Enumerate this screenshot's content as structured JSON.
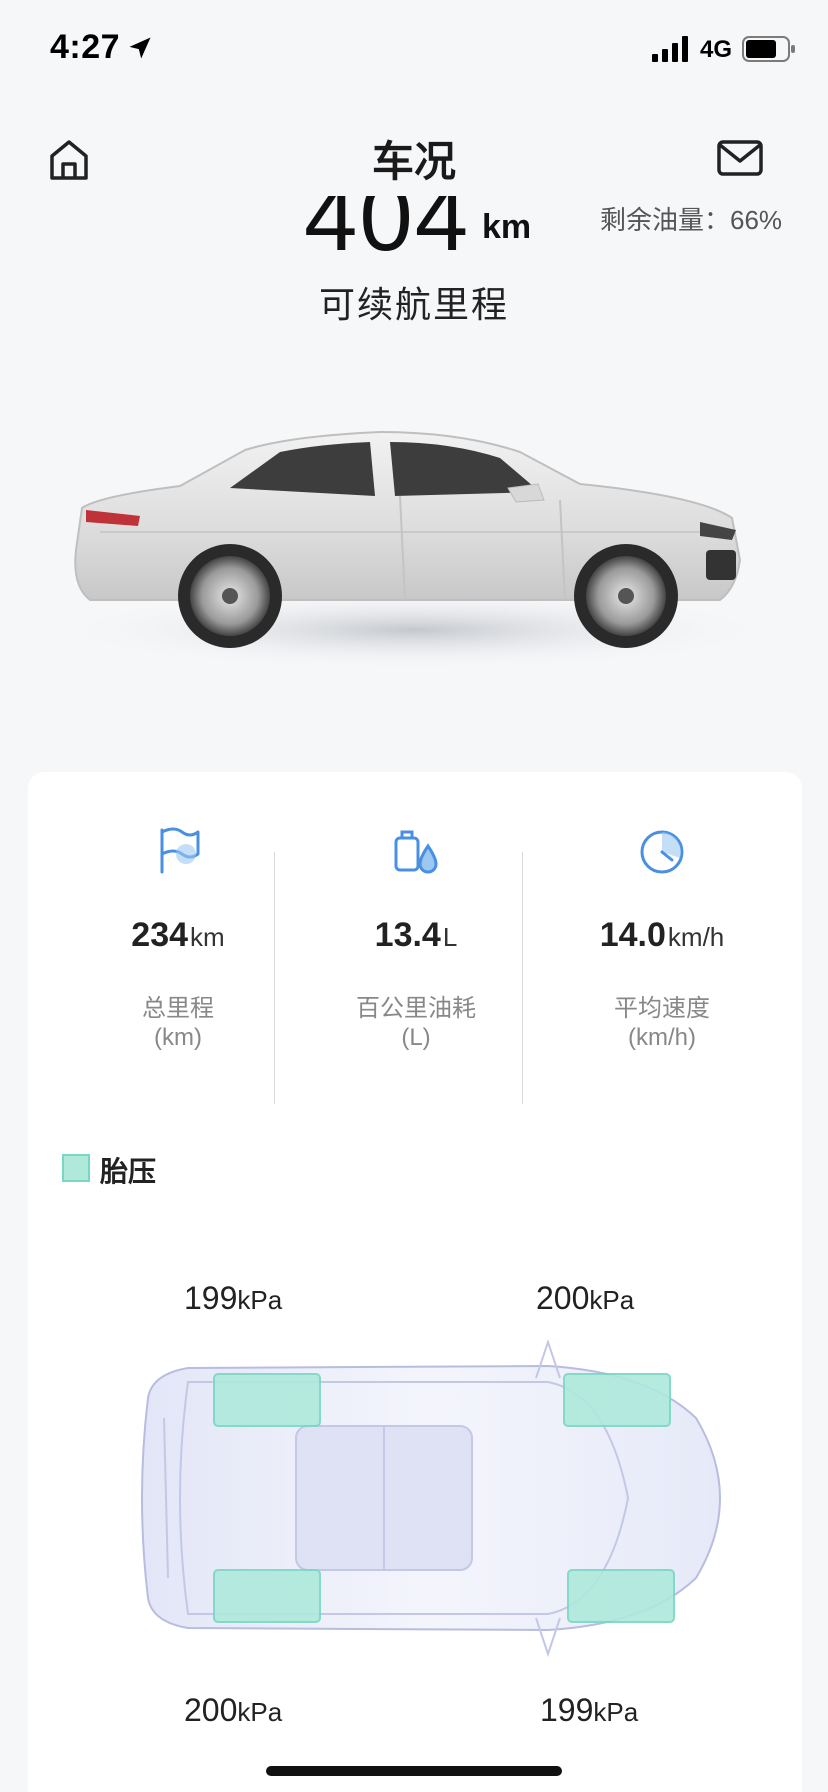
{
  "status_bar": {
    "time": "4:27",
    "network": "4G"
  },
  "header": {
    "title": "车况"
  },
  "range": {
    "value": "404",
    "unit": "km",
    "label": "可续航里程"
  },
  "fuel": {
    "text": "剩余油量：66%"
  },
  "stats": [
    {
      "value": "234",
      "unit": "km",
      "label": "总里程",
      "sub": "(km)",
      "icon": "flag-icon"
    },
    {
      "value": "13.4",
      "unit": "L",
      "label": "百公里油耗",
      "sub": "(L)",
      "icon": "fuel-drop-icon"
    },
    {
      "value": "14.0",
      "unit": "km/h",
      "label": "平均速度",
      "sub": "(km/h)",
      "icon": "speedometer-icon"
    }
  ],
  "tire_pressure": {
    "legend": "胎压",
    "unit": "kPa",
    "front_left": "199",
    "front_right": "200",
    "rear_left": "200",
    "rear_right": "199"
  },
  "colors": {
    "accent": "#4a90e2",
    "tire_fill": "#aee9dc"
  }
}
